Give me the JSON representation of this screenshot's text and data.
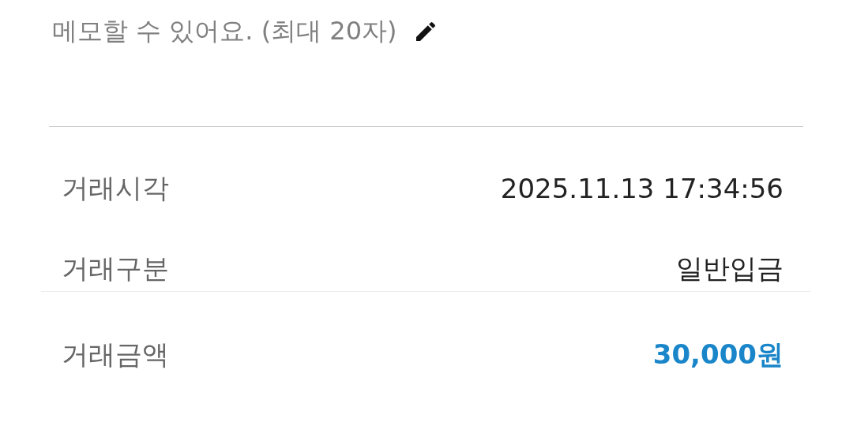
{
  "memo": {
    "placeholder": "메모할 수 있어요. (최대 20자)"
  },
  "details": [
    {
      "label": "거래시각",
      "value": "2025.11.13 17:34:56"
    },
    {
      "label": "거래구분",
      "value": "일반입금"
    }
  ],
  "amount": {
    "label": "거래금액",
    "value": "30,000원"
  }
}
